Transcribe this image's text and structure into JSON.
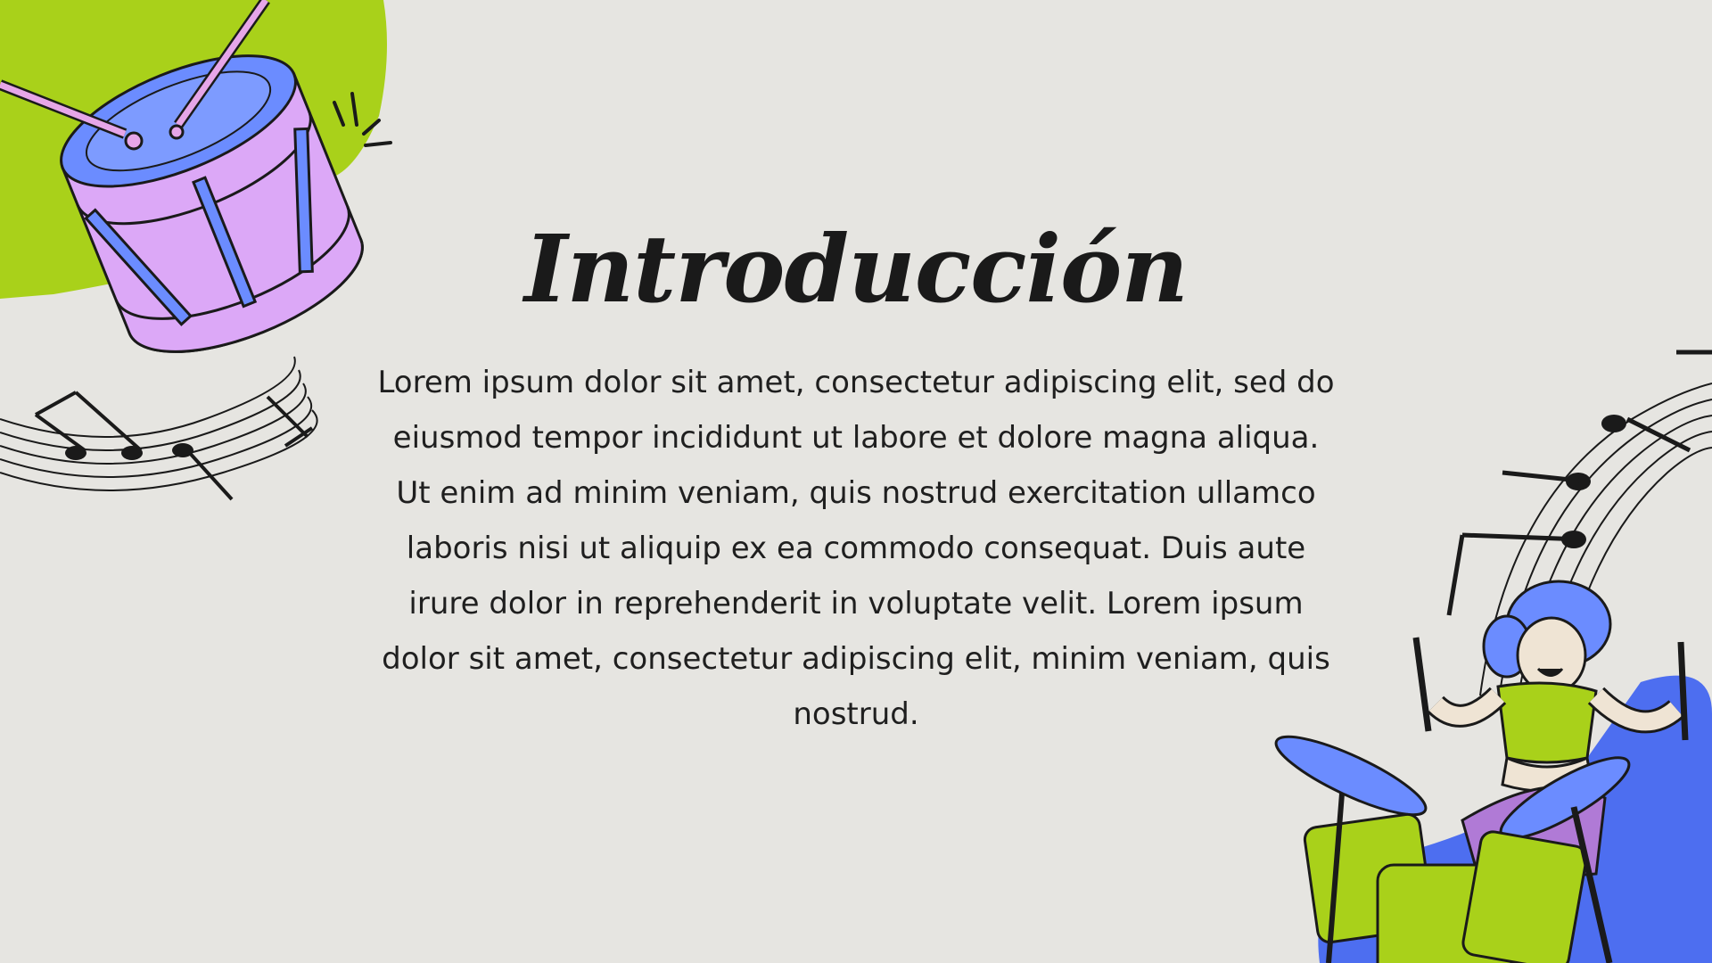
{
  "slide": {
    "title": "Introducción",
    "body": "Lorem ipsum dolor sit amet, consectetur adipiscing elit, sed do eiusmod tempor incididunt ut labore et dolore magna aliqua. Ut enim ad minim veniam, quis nostrud exercitation ullamco laboris nisi ut aliquip ex ea commodo consequat. Duis aute irure dolor in reprehenderit in voluptate velit. Lorem ipsum dolor sit amet, consectetur adipiscing elit, minim veniam, quis nostrud."
  },
  "colors": {
    "background": "#e6e5e1",
    "lime": "#a9d11a",
    "blue": "#6b8cff",
    "royal_blue": "#4d6ef0",
    "lilac": "#dca8f7",
    "pink": "#e6a6e8",
    "purple": "#b07ad6",
    "ink": "#1a1a1a"
  },
  "illustrations": [
    "drum-with-sticks",
    "music-staff-left",
    "music-staff-right",
    "drummer-girl"
  ]
}
